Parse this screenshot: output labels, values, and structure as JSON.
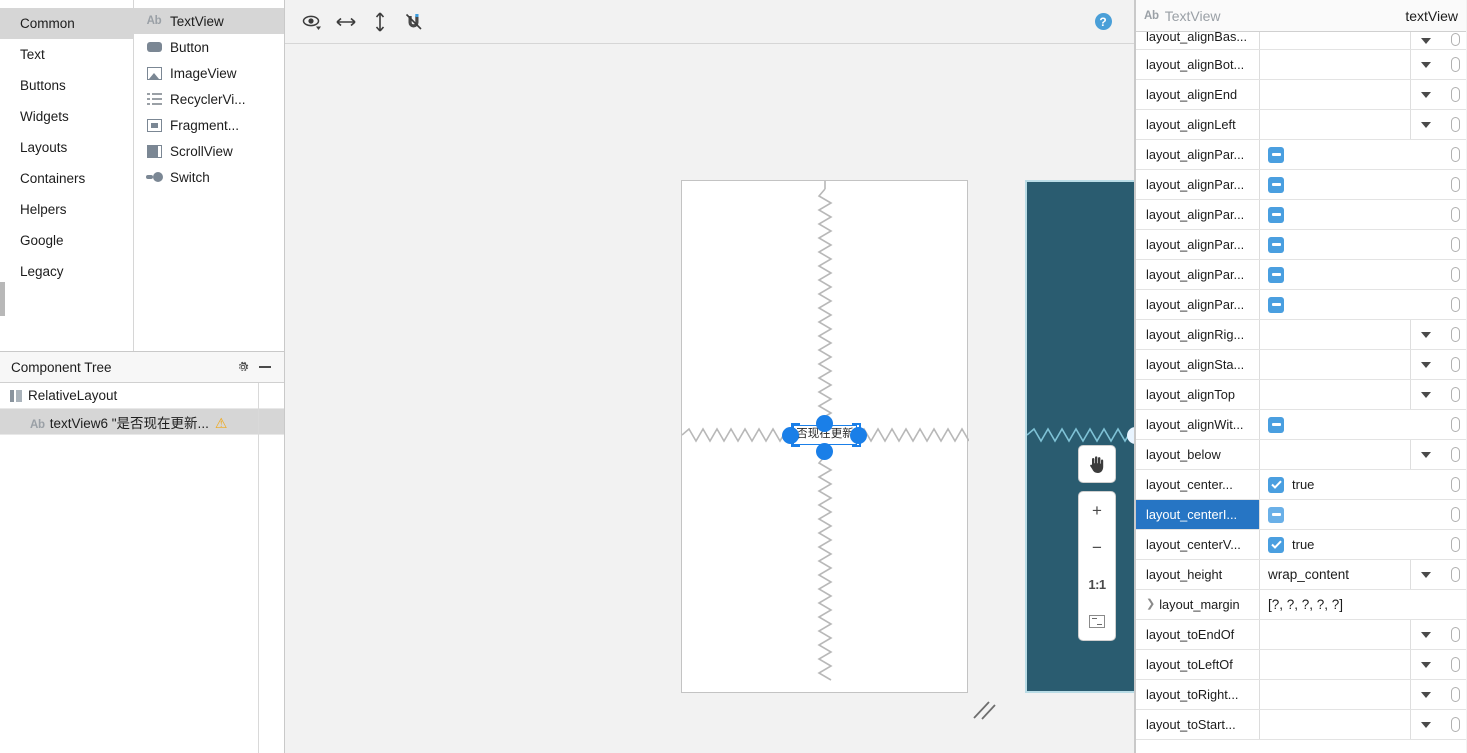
{
  "palette": {
    "groups": [
      {
        "label": "Common",
        "selected": true
      },
      {
        "label": "Text",
        "selected": false
      },
      {
        "label": "Buttons",
        "selected": false
      },
      {
        "label": "Widgets",
        "selected": false
      },
      {
        "label": "Layouts",
        "selected": false
      },
      {
        "label": "Containers",
        "selected": false
      },
      {
        "label": "Helpers",
        "selected": false
      },
      {
        "label": "Google",
        "selected": false
      },
      {
        "label": "Legacy",
        "selected": false
      }
    ],
    "items": [
      {
        "label": "TextView",
        "icon": "ab-text-icon",
        "selected": true
      },
      {
        "label": "Button",
        "icon": "button-icon",
        "selected": false
      },
      {
        "label": "ImageView",
        "icon": "image-icon",
        "selected": false
      },
      {
        "label": "RecyclerVi...",
        "icon": "list-icon",
        "selected": false
      },
      {
        "label": "Fragment...",
        "icon": "fragment-icon",
        "selected": false
      },
      {
        "label": "ScrollView",
        "icon": "scrollview-icon",
        "selected": false
      },
      {
        "label": "Switch",
        "icon": "switch-icon",
        "selected": false
      }
    ]
  },
  "component_tree": {
    "title": "Component Tree",
    "gear_label": "gear-icon",
    "minimize_label": "minus-icon",
    "rows": [
      {
        "label": "RelativeLayout",
        "icon": "relative-layout-icon",
        "depth": 0,
        "selected": false,
        "warning": false
      },
      {
        "label": "textView6 \"是否现在更新...",
        "icon": "ab-text-icon",
        "depth": 1,
        "selected": true,
        "warning": true
      }
    ]
  },
  "design_toolbar": {
    "buttons": [
      {
        "name": "eye-icon",
        "title": "View options"
      },
      {
        "name": "horizontal-arrows-icon",
        "title": "Horizontal guidelines"
      },
      {
        "name": "vertical-arrows-icon",
        "title": "Vertical guidelines"
      },
      {
        "name": "magnet-off-icon",
        "title": "Autoconnect off"
      }
    ],
    "help_label": "?"
  },
  "canvas": {
    "widget_text": "否现在更新",
    "blueprint_bg": "#2a5c70",
    "blueprint_border": "#b9dce6",
    "selection_color": "#1a7fe8",
    "zoom_controls": {
      "pan": "hand-icon",
      "zoom_in": "+",
      "zoom_out": "−",
      "actual_size": "1:1",
      "zoom_to_fit": "fit-icon"
    }
  },
  "attributes": {
    "header": {
      "type_icon": "ab-text-icon",
      "type": "TextView",
      "id": "textView"
    },
    "rows": [
      {
        "name": "layout_alignBas...",
        "kind": "dropdown",
        "value": "",
        "selected": false,
        "clipped": true
      },
      {
        "name": "layout_alignBot...",
        "kind": "dropdown",
        "value": "",
        "selected": false
      },
      {
        "name": "layout_alignEnd",
        "kind": "dropdown",
        "value": "",
        "selected": false
      },
      {
        "name": "layout_alignLeft",
        "kind": "dropdown",
        "value": "",
        "selected": false
      },
      {
        "name": "layout_alignPar...",
        "kind": "tristate",
        "value": "",
        "selected": false
      },
      {
        "name": "layout_alignPar...",
        "kind": "tristate",
        "value": "",
        "selected": false
      },
      {
        "name": "layout_alignPar...",
        "kind": "tristate",
        "value": "",
        "selected": false
      },
      {
        "name": "layout_alignPar...",
        "kind": "tristate",
        "value": "",
        "selected": false
      },
      {
        "name": "layout_alignPar...",
        "kind": "tristate",
        "value": "",
        "selected": false
      },
      {
        "name": "layout_alignPar...",
        "kind": "tristate",
        "value": "",
        "selected": false
      },
      {
        "name": "layout_alignRig...",
        "kind": "dropdown",
        "value": "",
        "selected": false
      },
      {
        "name": "layout_alignSta...",
        "kind": "dropdown",
        "value": "",
        "selected": false
      },
      {
        "name": "layout_alignTop",
        "kind": "dropdown",
        "value": "",
        "selected": false
      },
      {
        "name": "layout_alignWit...",
        "kind": "tristate",
        "value": "",
        "selected": false
      },
      {
        "name": "layout_below",
        "kind": "dropdown",
        "value": "",
        "selected": false
      },
      {
        "name": "layout_center...",
        "kind": "checked",
        "value": "true",
        "selected": false
      },
      {
        "name": "layout_centerI...",
        "kind": "tristate",
        "value": "",
        "selected": true
      },
      {
        "name": "layout_centerV...",
        "kind": "checked",
        "value": "true",
        "selected": false
      },
      {
        "name": "layout_height",
        "kind": "text-dropdown",
        "value": "wrap_content",
        "selected": false
      },
      {
        "name": "layout_margin",
        "kind": "expandable",
        "value": "[?, ?, ?, ?, ?]",
        "selected": false
      },
      {
        "name": "layout_toEndOf",
        "kind": "dropdown",
        "value": "",
        "selected": false
      },
      {
        "name": "layout_toLeftOf",
        "kind": "dropdown",
        "value": "",
        "selected": false
      },
      {
        "name": "layout_toRight...",
        "kind": "dropdown",
        "value": "",
        "selected": false
      },
      {
        "name": "layout_toStart...",
        "kind": "dropdown",
        "value": "",
        "selected": false
      }
    ]
  }
}
